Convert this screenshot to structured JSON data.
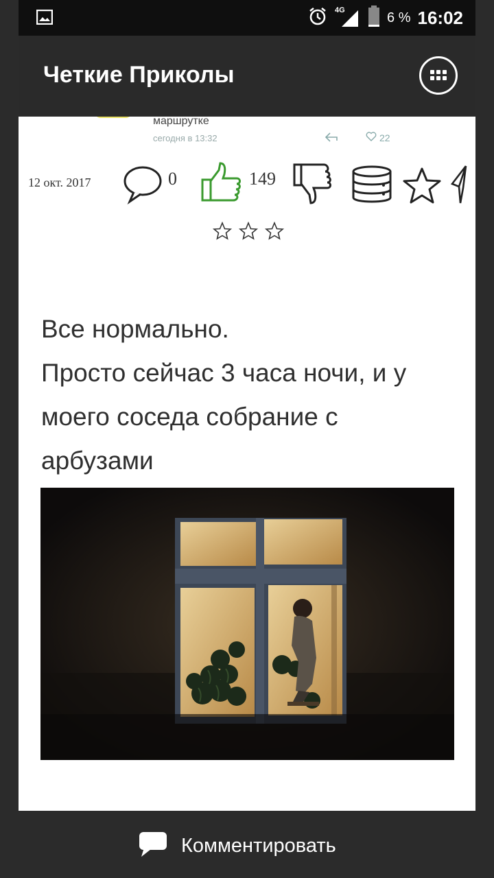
{
  "status_bar": {
    "network": "4G",
    "battery": "6 %",
    "time": "16:02",
    "icons": [
      "image-icon",
      "alarm-icon",
      "signal-icon",
      "battery-icon"
    ]
  },
  "app_bar": {
    "title": "Четкие Приколы",
    "menu_icon": "grid-menu-icon"
  },
  "post": {
    "previous_snippet": {
      "title": "маршрутке",
      "time": "сегодня в 13:32",
      "likes": "22"
    },
    "date": "12 окт. 2017",
    "comments_count": "0",
    "likes_count": "149",
    "rating_stars": 3,
    "text_lines": [
      "Все нормально.",
      "Просто сейчас 3 часа ночи, и у",
      "моего соседа собрание с",
      "арбузами"
    ]
  },
  "bottom_bar": {
    "comment_label": "Комментировать"
  },
  "colors": {
    "background": "#2b2b2b",
    "status_bar": "#0f0f0f",
    "like_green": "#3a9a2e",
    "card": "#ffffff"
  }
}
